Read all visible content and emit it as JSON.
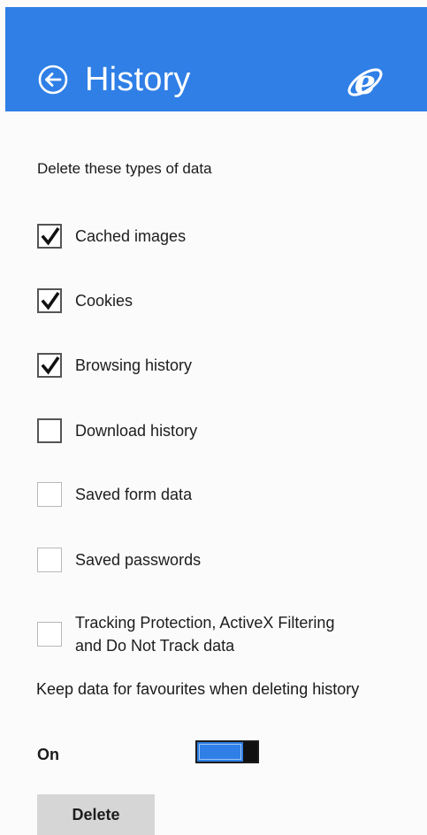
{
  "header": {
    "title": "History",
    "back_icon": "back-arrow-circle-icon",
    "app_icon": "internet-explorer-logo-icon",
    "background_color": "#2f7fe6"
  },
  "section": {
    "heading": "Delete these types of data"
  },
  "options": [
    {
      "label": "Cached images",
      "checked": true
    },
    {
      "label": "Cookies",
      "checked": true
    },
    {
      "label": "Browsing history",
      "checked": true
    },
    {
      "label": "Download history",
      "checked": false
    },
    {
      "label": "Saved form data",
      "checked": false
    },
    {
      "label": "Saved passwords",
      "checked": false
    },
    {
      "label": "Tracking Protection, ActiveX Filtering and Do Not Track data",
      "checked": false
    }
  ],
  "keep_favourites": {
    "text": "Keep data for favourites when deleting history",
    "state_label": "On",
    "on": true,
    "toggle_color": "#2f7fe6"
  },
  "actions": {
    "delete_label": "Delete"
  }
}
